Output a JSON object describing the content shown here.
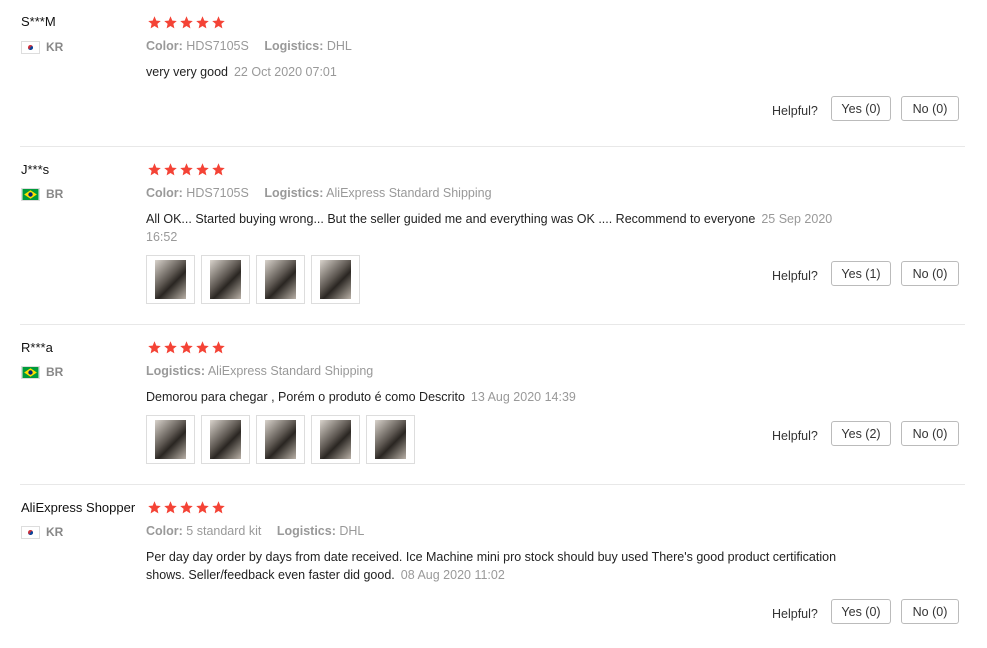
{
  "colors": {
    "star": "#f44336",
    "muted": "#999999",
    "border": "#bbbbbb"
  },
  "reviews": [
    {
      "user": "S***M",
      "country": "KR",
      "flag": "kr-flag-icon",
      "rating": 5,
      "meta": [
        {
          "k": "Color:",
          "v": "HDS7105S"
        },
        {
          "k": "Logistics:",
          "v": "DHL"
        }
      ],
      "text": "very very good",
      "date": "22 Oct 2020 07:01",
      "images": 0,
      "helpful_label": "Helpful?",
      "yes": "Yes (0)",
      "no": "No (0)"
    },
    {
      "user": "J***s",
      "country": "BR",
      "flag": "br-flag-icon",
      "rating": 5,
      "meta": [
        {
          "k": "Color:",
          "v": "HDS7105S"
        },
        {
          "k": "Logistics:",
          "v": "AliExpress Standard Shipping"
        }
      ],
      "text": "All OK... Started buying wrong... But the seller guided me and everything was OK .... Recommend to everyone",
      "date": "25 Sep 2020 16:52",
      "images": 4,
      "helpful_label": "Helpful?",
      "yes": "Yes (1)",
      "no": "No (0)"
    },
    {
      "user": "R***a",
      "country": "BR",
      "flag": "br-flag-icon",
      "rating": 5,
      "meta": [
        {
          "k": "Logistics:",
          "v": "AliExpress Standard Shipping"
        }
      ],
      "text": "Demorou para chegar , Porém o produto é como Descrito",
      "date": "13 Aug 2020 14:39",
      "images": 5,
      "helpful_label": "Helpful?",
      "yes": "Yes (2)",
      "no": "No (0)"
    },
    {
      "user": "AliExpress Shopper",
      "country": "KR",
      "flag": "kr-flag-icon",
      "rating": 5,
      "meta": [
        {
          "k": "Color:",
          "v": "5 standard kit"
        },
        {
          "k": "Logistics:",
          "v": "DHL"
        }
      ],
      "text": "Per day day order by days from date received. Ice Machine mini pro stock should buy used There's good product certification shows. Seller/feedback even faster did good.",
      "date": "08 Aug 2020 11:02",
      "images": 0,
      "helpful_label": "Helpful?",
      "yes": "Yes (0)",
      "no": "No (0)"
    }
  ]
}
